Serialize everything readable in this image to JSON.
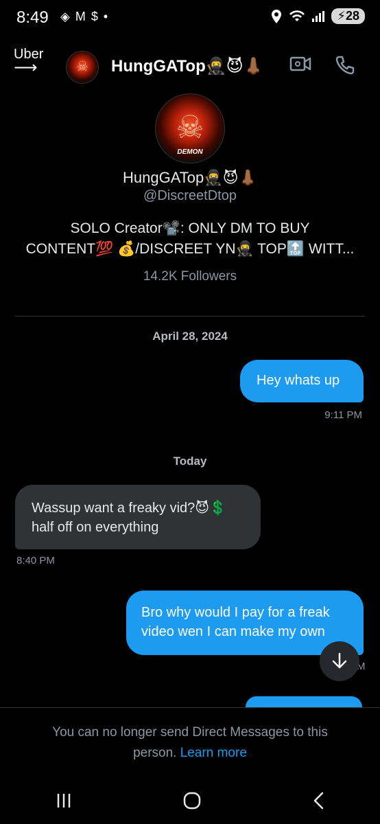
{
  "status_bar": {
    "time": "8:49",
    "notif_icons": [
      "◈",
      "M",
      "$",
      "•"
    ],
    "battery": "28"
  },
  "header": {
    "back_label": "Uber",
    "name": "HungGATop🥷😈👃🏾"
  },
  "profile": {
    "name": "HungGATop🥷😈👃🏾",
    "handle": "@DiscreetDtop",
    "bio_line1": "SOLO Creator📽️: ONLY DM TO BUY",
    "bio_line2": "CONTENT💯 💰/DISCREET YN🥷 TOP🔝 WITT...",
    "followers": "14.2K Followers",
    "avatar_text": "DEMON"
  },
  "messages": {
    "date1": "April 28, 2024",
    "msg1": "Hey whats up",
    "time1": "9:11 PM",
    "date2": "Today",
    "msg2_line1": "Wassup want a freaky vid?😈💲",
    "msg2_line2": "half off on everything",
    "time2": "8:40 PM",
    "msg3_line1": "Bro why would I pay for a freak",
    "msg3_line2": "video wen I can make my own",
    "time3_partial": "M"
  },
  "footer": {
    "notice_line1": "You can no longer send Direct Messages to this",
    "notice_line2_prefix": "person.",
    "learn_more": "Learn more"
  },
  "colors": {
    "accent": "#1d9bf0",
    "background": "#000000",
    "incoming_bubble": "#2f3336",
    "muted_text": "#8b98a5"
  }
}
